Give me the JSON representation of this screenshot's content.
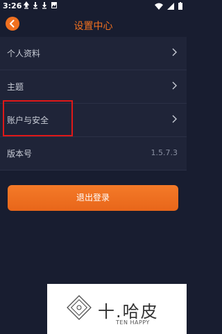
{
  "status_bar": {
    "time": "3:26",
    "notification_icons": [
      "upload-icon",
      "download-icon",
      "download-icon",
      "image-icon"
    ],
    "system_icons": [
      "wifi-icon",
      "signal-icon",
      "battery-icon"
    ]
  },
  "header": {
    "title": "设置中心",
    "back_icon": "chevron-left-icon",
    "accent_color": "#f07020"
  },
  "settings": [
    {
      "label": "个人资料",
      "icon": "chevron-right-icon"
    },
    {
      "label": "主题",
      "icon": "chevron-right-icon"
    },
    {
      "label": "账户与安全",
      "icon": "chevron-right-icon"
    },
    {
      "label": "版本号",
      "value": "1.5.7.3"
    }
  ],
  "highlight_color": "#e01818",
  "logout_button": {
    "label": "退出登录",
    "color": "#f07020"
  },
  "watermark": {
    "brand": "十.哈皮",
    "sub": "TEN HAPPY"
  },
  "colors": {
    "background": "#181d30",
    "row": "#1f2438"
  }
}
